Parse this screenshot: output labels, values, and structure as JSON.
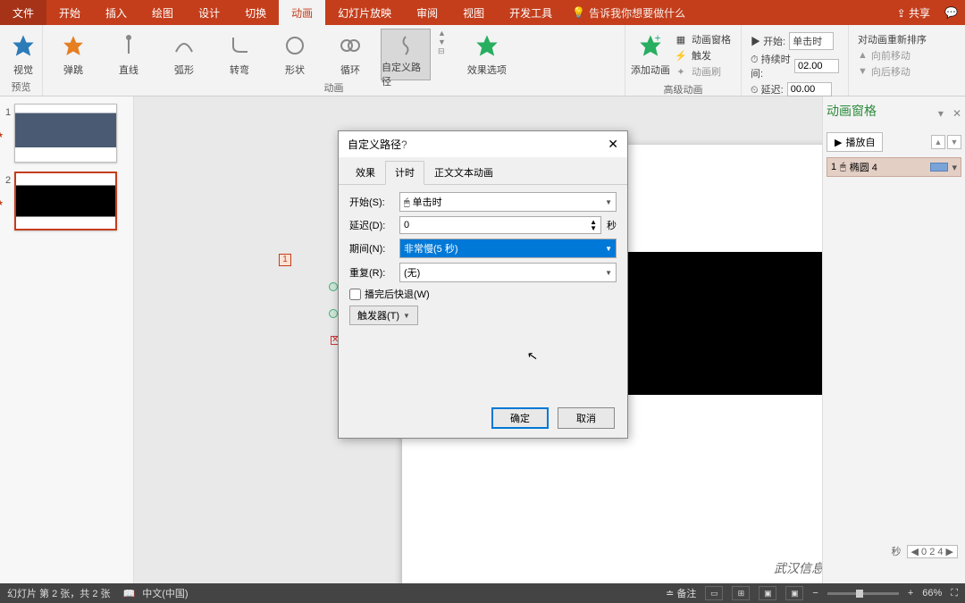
{
  "menu": {
    "file": "文件",
    "home": "开始",
    "insert": "插入",
    "draw": "绘图",
    "design": "设计",
    "transitions": "切换",
    "animations": "动画",
    "slideshow": "幻灯片放映",
    "review": "审阅",
    "view": "视图",
    "developer": "开发工具",
    "tell_me": "告诉我你想要做什么",
    "share": "共享"
  },
  "ribbon": {
    "preview": "预览",
    "preview_label": "视觉",
    "anim_group": "动画",
    "anims": {
      "bounce": "弹跳",
      "line": "直线",
      "arc": "弧形",
      "turn": "转弯",
      "shape": "形状",
      "loop": "循环",
      "custom_path": "自定义路径"
    },
    "effect_options": "效果选项",
    "add_anim": "添加动画",
    "anim_pane": "动画窗格",
    "trigger": "触发",
    "anim_painter": "动画刷",
    "advanced": "高级动画",
    "start_label": "开始:",
    "start_value": "单击时",
    "duration_label": "持续时间:",
    "duration_value": "02.00",
    "delay_label": "延迟:",
    "delay_value": "00.00",
    "timing": "计时",
    "reorder": "对动画重新排序",
    "move_earlier": "向前移动",
    "move_later": "向后移动"
  },
  "slides": {
    "s1_num": "1",
    "s2_num": "2",
    "seq": "1"
  },
  "canvas": {
    "watermark": "武汉信息传播职业技术学"
  },
  "dialog": {
    "title": "自定义路径",
    "tabs": {
      "effect": "效果",
      "timing": "计时",
      "text_anim": "正文文本动画"
    },
    "start_label": "开始(S):",
    "start_value": "单击时",
    "delay_label": "延迟(D):",
    "delay_value": "0",
    "delay_unit": "秒",
    "duration_label": "期间(N):",
    "duration_value": "非常慢(5 秒)",
    "repeat_label": "重复(R):",
    "repeat_value": "(无)",
    "rewind": "播完后快退(W)",
    "trigger_btn": "触发器(T)",
    "ok": "确定",
    "cancel": "取消"
  },
  "anim_pane": {
    "title": "动画窗格",
    "play": "播放自",
    "item_num": "1",
    "item_name": "椭圆 4",
    "seconds": "秒",
    "ticks": "0  2  4"
  },
  "status": {
    "slide_pos": "幻灯片 第 2 张，共 2 张",
    "lang": "中文(中国)",
    "notes": "备注",
    "zoom": "66%"
  }
}
